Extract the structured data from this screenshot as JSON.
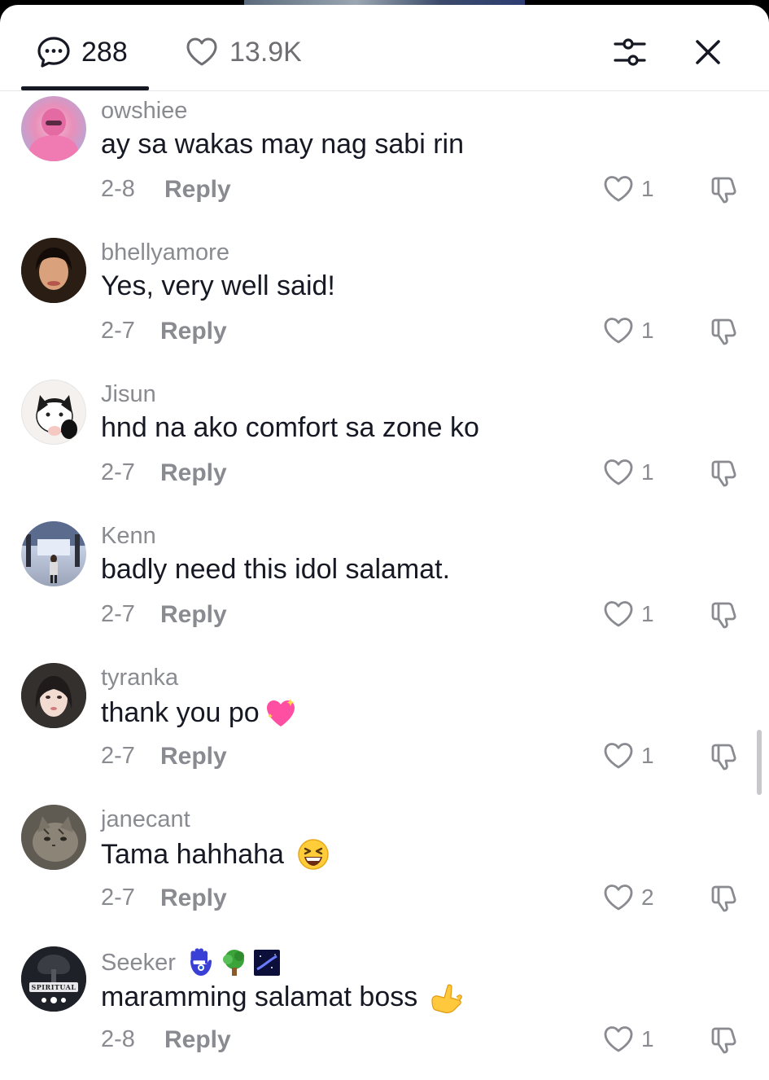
{
  "header": {
    "comments_count": "288",
    "likes_count": "13.9K"
  },
  "comments": [
    {
      "username": "owshiee",
      "text": "ay sa wakas may nag sabi rin",
      "date": "2-8",
      "reply_label": "Reply",
      "likes": "1"
    },
    {
      "username": "bhellyamore",
      "text": "Yes, very well said!",
      "date": "2-7",
      "reply_label": "Reply",
      "likes": "1"
    },
    {
      "username": "Jisun",
      "text": "hnd na ako comfort sa zone ko",
      "date": "2-7",
      "reply_label": "Reply",
      "likes": "1"
    },
    {
      "username": "Kenn",
      "text": "badly need this idol salamat.",
      "date": "2-7",
      "reply_label": "Reply",
      "likes": "1"
    },
    {
      "username": "tyranka",
      "text": "thank you po",
      "date": "2-7",
      "reply_label": "Reply",
      "likes": "1",
      "emoji": "sparkling-heart"
    },
    {
      "username": "janecant",
      "text": "Tama hahhaha",
      "date": "2-7",
      "reply_label": "Reply",
      "likes": "2",
      "emoji": "grinning-squinting-face"
    },
    {
      "username": "Seeker",
      "text": "maramming salamat boss",
      "date": "2-8",
      "reply_label": "Reply",
      "likes": "1",
      "emoji": "call-me-hand",
      "username_badges": [
        "hamsa-icon",
        "tree-icon",
        "galaxy-icon"
      ],
      "avatar_text": "SPIRITUAL"
    }
  ],
  "colors": {
    "text_primary": "#161823",
    "text_secondary": "#8a8b91",
    "accent_heart_emoji": "#ff4fa3"
  }
}
